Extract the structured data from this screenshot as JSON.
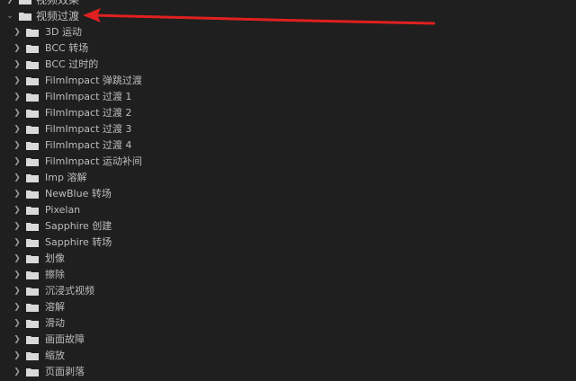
{
  "tree": {
    "parent_above": {
      "label": "视频效果"
    },
    "category": {
      "label": "视频过渡",
      "expanded": true
    },
    "items": [
      {
        "label": "3D 运动"
      },
      {
        "label": "BCC 转场"
      },
      {
        "label": "BCC 过时的"
      },
      {
        "label": "FilmImpact 弹跳过渡"
      },
      {
        "label": "FilmImpact 过渡 1"
      },
      {
        "label": "FilmImpact 过渡 2"
      },
      {
        "label": "FilmImpact 过渡 3"
      },
      {
        "label": "FilmImpact 过渡 4"
      },
      {
        "label": "FilmImpact 运动补间"
      },
      {
        "label": "Imp 溶解"
      },
      {
        "label": "NewBlue 转场"
      },
      {
        "label": "Pixelan"
      },
      {
        "label": "Sapphire 创建"
      },
      {
        "label": "Sapphire 转场"
      },
      {
        "label": "划像"
      },
      {
        "label": "擦除"
      },
      {
        "label": "沉浸式视频"
      },
      {
        "label": "溶解"
      },
      {
        "label": "滑动"
      },
      {
        "label": "画面故障"
      },
      {
        "label": "缩放"
      },
      {
        "label": "页面剥落"
      }
    ]
  },
  "colors": {
    "background": "#1f1f1f",
    "text": "#bdbdbd",
    "folder": "#d9d9d9",
    "annotation_arrow": "#e02020"
  },
  "icons": {
    "folder": "folder-icon",
    "collapsed": "chevron-right-icon",
    "expanded": "chevron-down-icon"
  }
}
